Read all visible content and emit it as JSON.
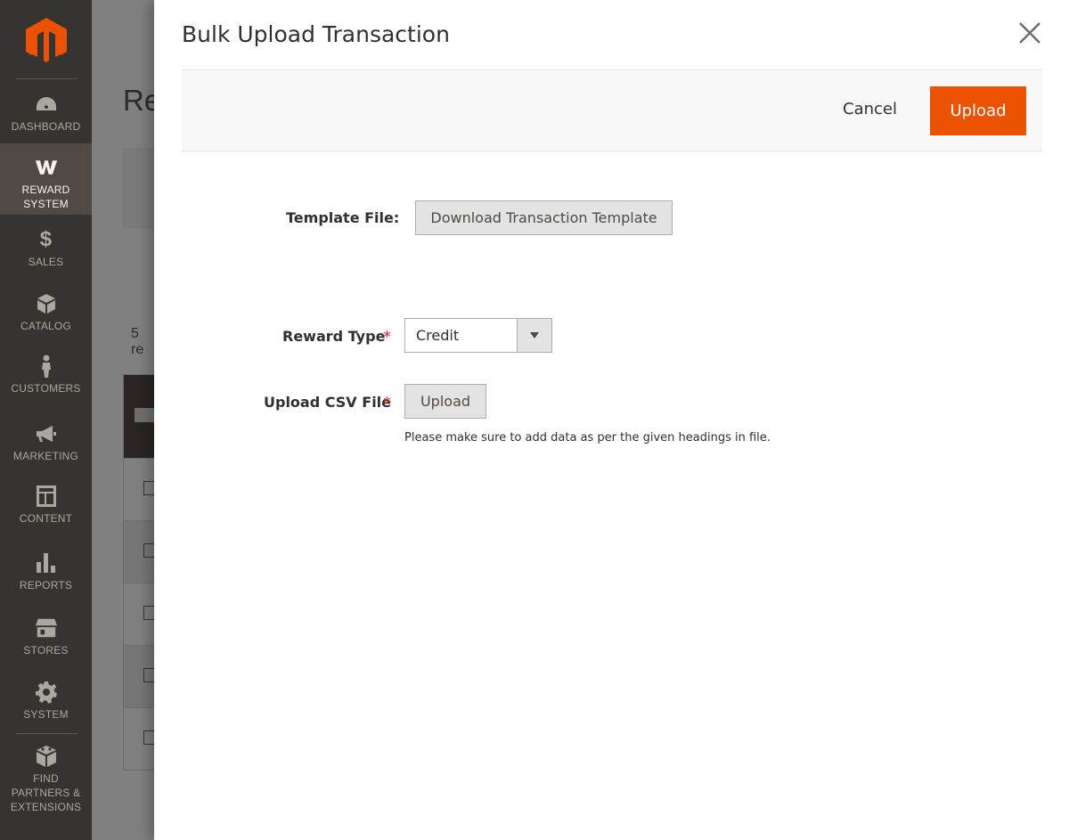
{
  "sidebar": {
    "items": [
      {
        "label": "DASHBOARD",
        "icon": "dashboard-icon"
      },
      {
        "label": "REWARD SYSTEM",
        "icon": "reward-icon"
      },
      {
        "label": "SALES",
        "icon": "dollar-icon"
      },
      {
        "label": "CATALOG",
        "icon": "box-icon"
      },
      {
        "label": "CUSTOMERS",
        "icon": "person-icon"
      },
      {
        "label": "MARKETING",
        "icon": "megaphone-icon"
      },
      {
        "label": "CONTENT",
        "icon": "layout-icon"
      },
      {
        "label": "REPORTS",
        "icon": "bar-chart-icon"
      },
      {
        "label": "STORES",
        "icon": "store-icon"
      },
      {
        "label": "SYSTEM",
        "icon": "gear-icon"
      },
      {
        "label": "FIND PARTNERS & EXTENSIONS",
        "icon": "blocks-icon"
      }
    ]
  },
  "background": {
    "title_fragment": "Re",
    "count_fragment": "5 re"
  },
  "modal": {
    "title": "Bulk Upload Transaction",
    "cancel_label": "Cancel",
    "upload_label": "Upload",
    "template_label": "Template File:",
    "download_label": "Download Transaction Template",
    "reward_type_label": "Reward Type",
    "reward_type_value": "Credit",
    "csv_label": "Upload CSV File",
    "csv_button": "Upload",
    "note": "Please make sure to add data as per the given headings in file.",
    "required_mark": "*"
  },
  "colors": {
    "accent": "#eb5202",
    "sidebar": "#373330",
    "required": "#e22626"
  }
}
